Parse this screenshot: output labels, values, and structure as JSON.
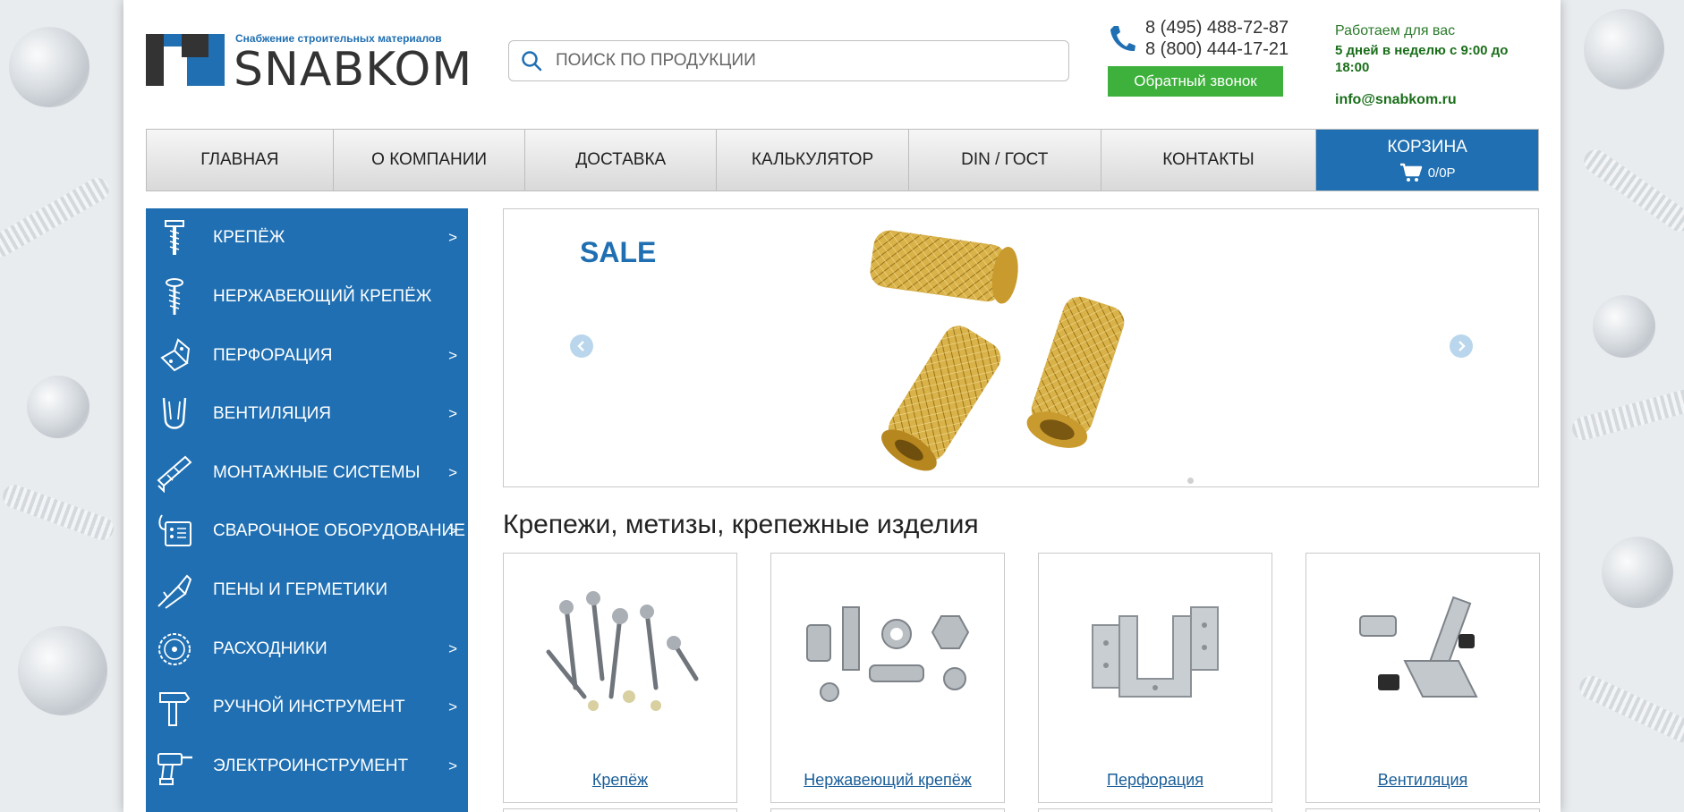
{
  "header": {
    "logo_tagline": "Снабжение строительных материалов",
    "logo_name": "SNABKOM",
    "search_placeholder": "ПОИСК ПО ПРОДУКЦИИ",
    "phone_1": "8 (495) 488-72-87",
    "phone_2": "8 (800) 444-17-21",
    "callback_label": "Обратный звонок",
    "hours_label": "Работаем для вас",
    "hours_value": "5 дней в неделю с 9:00 до 18:00",
    "email": "info@snabkom.ru"
  },
  "nav": {
    "items": [
      {
        "label": "ГЛАВНАЯ"
      },
      {
        "label": "О КОМПАНИИ"
      },
      {
        "label": "ДОСТАВКА"
      },
      {
        "label": "КАЛЬКУЛЯТОР"
      },
      {
        "label": "DIN / ГОСТ"
      },
      {
        "label": "КОНТАКТЫ"
      }
    ],
    "cart_label": "КОРЗИНА",
    "cart_value": "0/0Р"
  },
  "sidebar": {
    "items": [
      {
        "label": "КРЕПЁЖ",
        "arrow": ">",
        "icon": "screw-icon"
      },
      {
        "label": "НЕРЖАВЕЮЩИЙ КРЕПЁЖ",
        "arrow": "",
        "icon": "self-tapping-screw-icon"
      },
      {
        "label": "ПЕРФОРАЦИЯ",
        "arrow": ">",
        "icon": "angle-bracket-icon"
      },
      {
        "label": "ВЕНТИЛЯЦИЯ",
        "arrow": ">",
        "icon": "clamp-icon"
      },
      {
        "label": "МОНТАЖНЫЕ СИСТЕМЫ",
        "arrow": ">",
        "icon": "mounting-rail-icon"
      },
      {
        "label": "СВАРОЧНОЕ ОБОРУДОВАНИЕ",
        "arrow": ">",
        "icon": "welding-machine-icon"
      },
      {
        "label": "ПЕНЫ И ГЕРМЕТИКИ",
        "arrow": "",
        "icon": "foam-gun-icon"
      },
      {
        "label": "РАСХОДНИКИ",
        "arrow": ">",
        "icon": "saw-disc-icon"
      },
      {
        "label": "РУЧНОЙ ИНСТРУМЕНТ",
        "arrow": ">",
        "icon": "hammer-icon"
      },
      {
        "label": "ЭЛЕКТРОИНСТРУМЕНТ",
        "arrow": ">",
        "icon": "drill-icon"
      }
    ]
  },
  "slider": {
    "label": "SALE"
  },
  "section_title": "Крепежи, метизы, крепежные изделия",
  "cards": [
    {
      "label": "Крепёж"
    },
    {
      "label": "Нержавеющий крепёж"
    },
    {
      "label": "Перфорация"
    },
    {
      "label": "Вентиляция"
    }
  ],
  "colors": {
    "brand_blue": "#1f6fb2",
    "callback_green": "#3db13b",
    "hours_green": "#1a6e1a"
  }
}
